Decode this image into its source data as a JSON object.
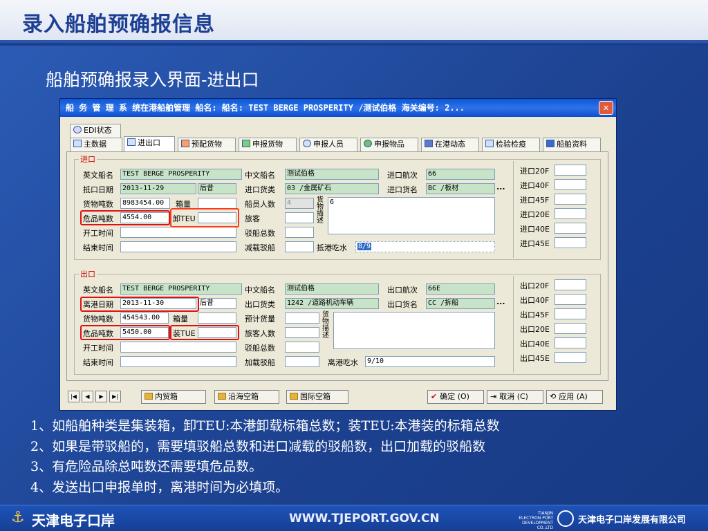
{
  "slide": {
    "title": "录入船舶预确报信息",
    "subtitle": "船舶预确报录入界面-进出口",
    "notes": [
      "1、如船舶种类是集装箱，卸TEU:本港卸载标箱总数；装TEU:本港装的标箱总数",
      "2、如果是带驳船的，需要填驳船总数和进口减载的驳船数，出口加载的驳船数",
      "3、有危险品除总吨数还需要填危品数。",
      "4、发送出口申报单时，离港时间为必填项。"
    ],
    "footer": {
      "logo": "天津电子口岸",
      "url": "WWW.TJEPORT.GOV.CN",
      "small_en_1": "TIANJIN",
      "small_en_2": "ELECTRON PORT",
      "small_en_3": "DEVELOPMENT CO.,LTD",
      "company": "天津电子口岸发展有限公司"
    }
  },
  "window": {
    "title": "船 务 管 理 系 统在港船舶管理  船名: 船名: TEST BERGE PROSPERITY /测试伯格  海关编号: 2...",
    "close": "✕",
    "tab_edi": "EDI状态",
    "tabs": [
      "主数据",
      "进出口",
      "预配货物",
      "申报货物",
      "申报人员",
      "申报物品",
      "在港动态",
      "检验检疫",
      "船舶资料"
    ],
    "import": {
      "group": "进口",
      "en_name_label": "英文船名",
      "en_name": "TEST BERGE PROSPERITY",
      "cn_name_label": "中文船名",
      "cn_name": "测试伯格",
      "voyage_label": "进口航次",
      "voyage": "66",
      "arrive_label": "抵口日期",
      "arrive_date": "2013-11-29",
      "arrive_tail": "后昔",
      "cargo_type_label": "进口货类",
      "cargo_type": "03   /金属矿石",
      "goods_label": "进口货名",
      "goods": "BC  /板材",
      "tonnage_label": "货物吨数",
      "tonnage": "8983454.00",
      "boxes_label": "箱量",
      "crew_label": "船员人数",
      "crew": "4",
      "desc_label": "货物描述",
      "desc": "6",
      "danger_label": "危品吨数",
      "danger": "4554.00",
      "teu_label": "卸TEU",
      "passenger_label": "旅客",
      "start_label": "开工时间",
      "barge_total_label": "驳船总数",
      "end_label": "结束时间",
      "barge_reduce_label": "减载驳船",
      "draft_label": "抵港吃水",
      "draft": "8/9",
      "box_labels": [
        "进口20F",
        "进口40F",
        "进口45F",
        "进口20E",
        "进口40E",
        "进口45E"
      ]
    },
    "export": {
      "group": "出口",
      "en_name_label": "英文船名",
      "en_name": "TEST BERGE PROSPERITY",
      "cn_name_label": "中文船名",
      "cn_name": "测试伯格",
      "voyage_label": "出口航次",
      "voyage": "66E",
      "leave_label": "离港日期",
      "leave_date": "2013-11-30",
      "leave_tail": "后昔",
      "cargo_type_label": "出口货类",
      "cargo_type": "1242 /道路机动车辆",
      "goods_label": "出口货名",
      "goods": "CC  /拆船",
      "tonnage_label": "货物吨数",
      "tonnage": "454543.00",
      "boxes_label": "箱量",
      "planned_label": "预计货量",
      "desc_label": "货物描述",
      "danger_label": "危品吨数",
      "danger": "5450.00",
      "teu_label": "装TUE",
      "passenger_label": "旅客人数",
      "start_label": "开工时间",
      "barge_total_label": "驳船总数",
      "end_label": "结束时间",
      "barge_add_label": "加载驳船",
      "draft_label": "离港吃水",
      "draft": "9/10",
      "box_labels": [
        "出口20F",
        "出口40F",
        "出口45F",
        "出口20E",
        "出口40E",
        "出口45E"
      ]
    },
    "bottom": {
      "nav": [
        "|◀",
        "◀",
        "▶",
        "▶|"
      ],
      "btn_domestic": "内贸箱",
      "btn_coastal": "沿海空箱",
      "btn_intl": "国际空箱",
      "btn_ok": "确定 (O)",
      "btn_cancel": "取消 (C)",
      "btn_apply": "应用 (A)"
    },
    "ellipsis": "..."
  }
}
